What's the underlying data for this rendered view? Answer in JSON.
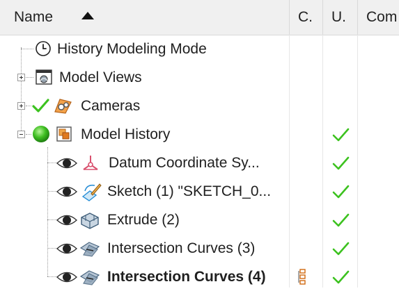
{
  "columns": {
    "name": "Name",
    "c": "C.",
    "u": "U.",
    "comment": "Com"
  },
  "sort": {
    "column": "name",
    "direction": "ascending"
  },
  "rows": [
    {
      "label": "History Modeling Mode",
      "icon": "clock-icon",
      "level": 0,
      "expandable": false,
      "bold": false,
      "up_to_date": false
    },
    {
      "label": "Model Views",
      "icon": "model-views-icon",
      "level": 0,
      "expandable": true,
      "expanded": false,
      "bold": false,
      "up_to_date": false
    },
    {
      "label": "Cameras",
      "icon": "camera-icon",
      "level": 0,
      "expandable": true,
      "expanded": false,
      "status_icon": "green-check-icon",
      "bold": false,
      "up_to_date": false
    },
    {
      "label": "Model History",
      "icon": "model-history-icon",
      "level": 0,
      "expandable": true,
      "expanded": true,
      "status_icon": "green-dot-icon",
      "bold": false,
      "up_to_date": true
    },
    {
      "label": "Datum Coordinate Sy...",
      "icon": "datum-csys-icon",
      "level": 1,
      "visible": true,
      "bold": false,
      "up_to_date": true
    },
    {
      "label": "Sketch (1) \"SKETCH_0...",
      "icon": "sketch-icon",
      "level": 1,
      "visible": true,
      "bold": false,
      "up_to_date": true
    },
    {
      "label": "Extrude (2)",
      "icon": "extrude-icon",
      "level": 1,
      "visible": true,
      "bold": false,
      "up_to_date": true
    },
    {
      "label": "Intersection Curves (3)",
      "icon": "intersection-curves-icon",
      "level": 1,
      "visible": true,
      "bold": false,
      "up_to_date": true
    },
    {
      "label": "Intersection Curves (4)",
      "icon": "intersection-curves-icon",
      "level": 1,
      "visible": true,
      "bold": true,
      "up_to_date": true,
      "current_icon": "current-feature-icon"
    }
  ],
  "colors": {
    "check_green": "#3cc21f",
    "header_bg": "#f0f0f0",
    "icon_accent": "#e07a1f",
    "datum_pink": "#d9506e",
    "sketch_blue": "#2a8fd6"
  }
}
